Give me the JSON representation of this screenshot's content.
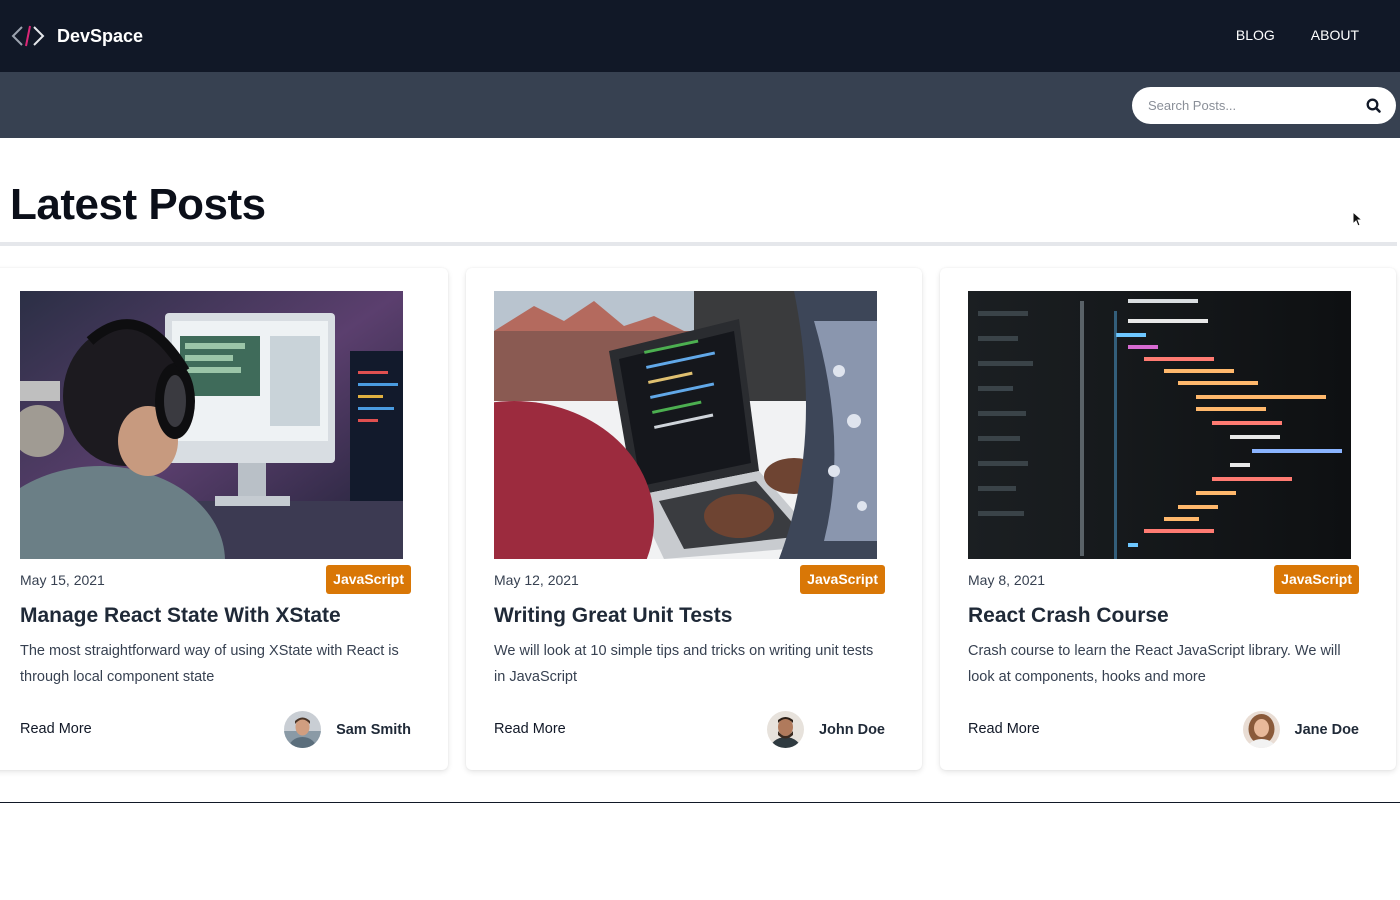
{
  "header": {
    "brand_name": "DevSpace",
    "nav": [
      "BLOG",
      "ABOUT"
    ]
  },
  "search": {
    "placeholder": "Search Posts...",
    "value": ""
  },
  "main": {
    "title": "Latest Posts"
  },
  "posts": [
    {
      "date": "May 15, 2021",
      "category": "JavaScript",
      "title": "Manage React State With XState",
      "excerpt": "The most straightforward way of using XState with React is through local component state",
      "read_more": "Read More",
      "author": "Sam Smith"
    },
    {
      "date": "May 12, 2021",
      "category": "JavaScript",
      "title": "Writing Great Unit Tests",
      "excerpt": "We will look at 10 simple tips and tricks on writing unit tests in JavaScript",
      "read_more": "Read More",
      "author": "John Doe"
    },
    {
      "date": "May 8, 2021",
      "category": "JavaScript",
      "title": "React Crash Course",
      "excerpt": "Crash course to learn the React JavaScript library. We will look at components, hooks and more",
      "read_more": "Read More",
      "author": "Jane Doe"
    }
  ],
  "colors": {
    "header_bg": "#111827",
    "search_band_bg": "#374151",
    "badge_bg": "#d97706"
  },
  "icons": {
    "logo": "code-brackets-icon",
    "search": "search-icon"
  }
}
